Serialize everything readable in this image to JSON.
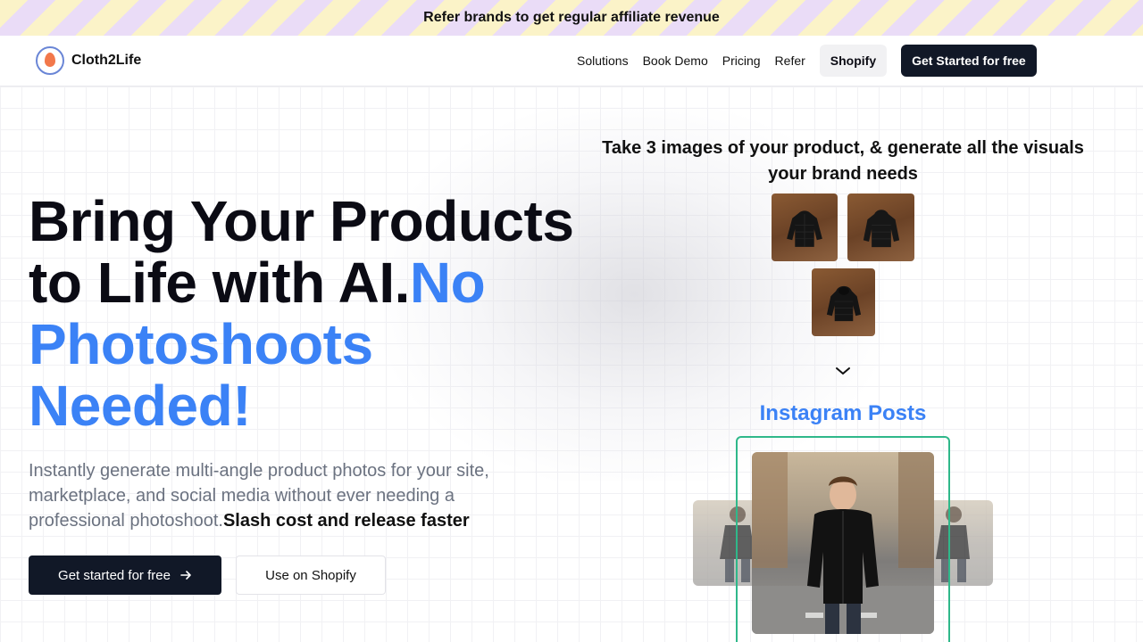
{
  "announcement": {
    "text": "Refer brands to get regular affiliate revenue"
  },
  "header": {
    "logo_text": "Cloth2Life",
    "nav": [
      "Solutions",
      "Book Demo",
      "Pricing",
      "Refer"
    ],
    "shopify_label": "Shopify",
    "cta_label": "Get Started for free"
  },
  "hero": {
    "headline_part1": "Bring Your Products to Life with AI.",
    "headline_accent": "No Photoshoots Needed!",
    "subtext": "Instantly generate multi-angle product photos for your site, marketplace, and social media without ever needing a professional photoshoot.",
    "subtext_strong": "Slash cost and release faster",
    "primary_button": "Get started for free",
    "secondary_button": "Use on Shopify"
  },
  "showcase": {
    "title": "Take 3 images of your product, & generate all the visuals your brand needs",
    "output_label": "Instagram Posts",
    "input_images": [
      "jacket-front",
      "jacket-back",
      "jacket-hood"
    ]
  },
  "colors": {
    "accent": "#3b82f6",
    "dark": "#111827",
    "frame": "#2fb88a"
  }
}
